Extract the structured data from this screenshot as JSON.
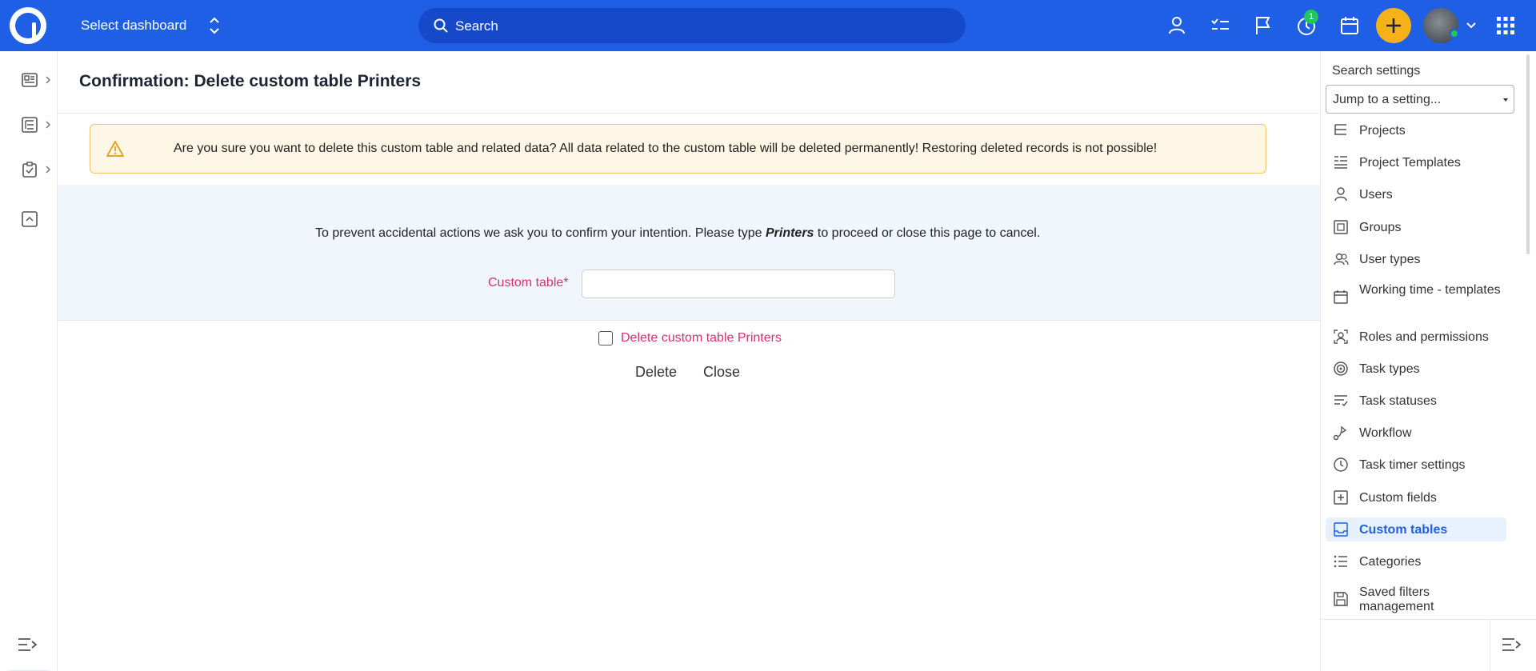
{
  "topbar": {
    "dashboard_label": "Select dashboard",
    "search_placeholder": "Search",
    "timer_badge": "1",
    "icons": [
      "user-icon",
      "tasks-icon",
      "flag-icon",
      "timer-icon",
      "calendar-icon",
      "plus-icon",
      "avatar",
      "chevron-down-icon",
      "apps-grid-icon"
    ],
    "colors": {
      "bar": "#1f5fe6",
      "search": "#1649c9",
      "plus": "#f5b21b",
      "badge": "#22c55e"
    }
  },
  "left_sidebar": {
    "icons": [
      "dashboard-icon",
      "projects-tree-icon",
      "tasks-clipboard-icon",
      "collapse-box-icon",
      "expand-menu-icon"
    ]
  },
  "main": {
    "title": "Confirmation: Delete custom table Printers",
    "alert_text": "Are you sure you want to delete this custom table and related data? All data related to the custom table will be deleted permanently! Restoring deleted records is not possible!",
    "confirm_text_before": "To prevent accidental actions we ask you to confirm your intention. Please type ",
    "confirm_keyword": "Printers",
    "confirm_text_after": " to proceed or close this page to cancel.",
    "field_label": "Custom table*",
    "field_value": "",
    "checkbox_label": "Delete custom table Printers",
    "checkbox_checked": false,
    "delete_label": "Delete",
    "close_label": "Close",
    "colors": {
      "alert_bg": "#fff7e6",
      "alert_border": "#f1c46b",
      "panel_bg": "#f1f6fc",
      "required_label": "#d6336c"
    }
  },
  "settings_panel": {
    "title": "Search settings",
    "jump_placeholder": "Jump to a setting...",
    "items": [
      {
        "label": "Projects",
        "icon": "projects-icon"
      },
      {
        "label": "Project Templates",
        "icon": "project-templates-icon"
      },
      {
        "label": "Users",
        "icon": "user-icon"
      },
      {
        "label": "Groups",
        "icon": "groups-icon"
      },
      {
        "label": "User types",
        "icon": "user-types-icon"
      },
      {
        "label": "Working time - templates",
        "icon": "calendar-icon"
      },
      {
        "label": "Roles and permissions",
        "icon": "roles-icon"
      },
      {
        "label": "Task types",
        "icon": "target-icon"
      },
      {
        "label": "Task statuses",
        "icon": "statuses-icon"
      },
      {
        "label": "Workflow",
        "icon": "workflow-icon"
      },
      {
        "label": "Task timer settings",
        "icon": "clock-icon"
      },
      {
        "label": "Custom fields",
        "icon": "plus-box-icon"
      },
      {
        "label": "Custom tables",
        "icon": "inbox-icon",
        "active": true
      },
      {
        "label": "Categories",
        "icon": "list-icon"
      },
      {
        "label": "Saved filters management",
        "icon": "save-icon"
      }
    ],
    "active_color": "#1f5fe6"
  }
}
